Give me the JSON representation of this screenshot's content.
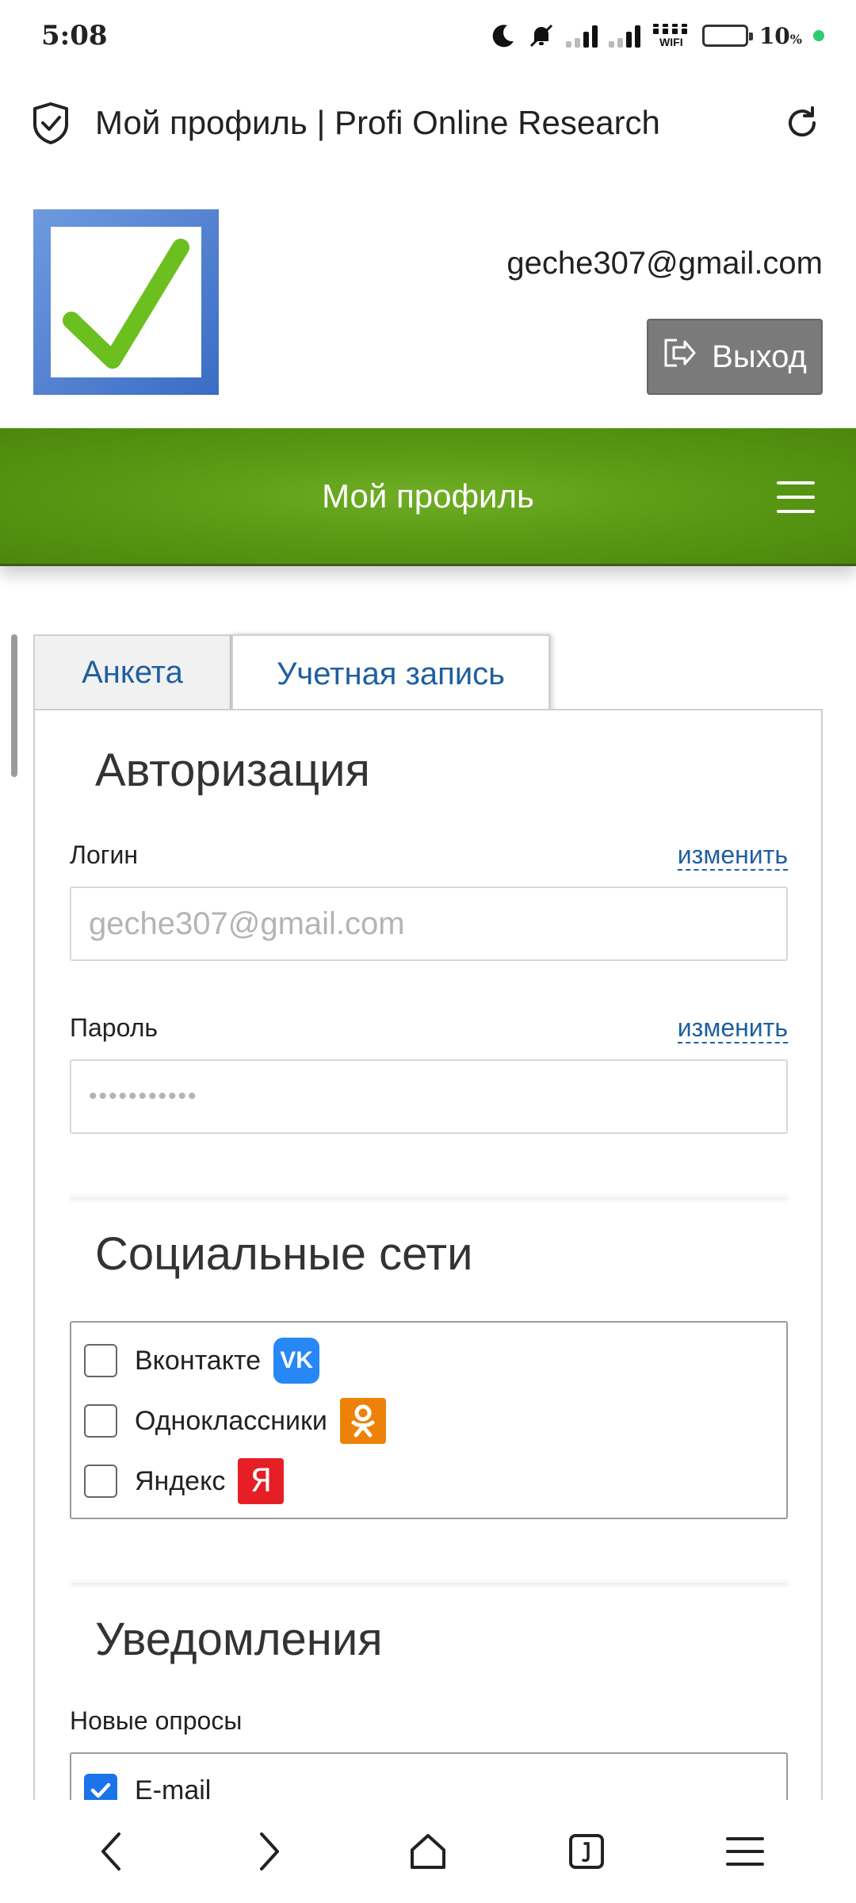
{
  "status_bar": {
    "time": "5:08",
    "wifi_label": "WIFI",
    "battery_level": 10,
    "battery_text": "10",
    "battery_unit": "%"
  },
  "browser": {
    "page_title": "Мой профиль | Profi Online Research"
  },
  "header": {
    "user_email": "geche307@gmail.com",
    "logout_label": "Выход"
  },
  "nav": {
    "title": "Мой профиль"
  },
  "tabs": [
    {
      "label": "Анкета",
      "active": false
    },
    {
      "label": "Учетная запись",
      "active": true
    }
  ],
  "auth": {
    "title": "Авторизация",
    "login_label": "Логин",
    "login_change": "изменить",
    "login_value": "geche307@gmail.com",
    "password_label": "Пароль",
    "password_change": "изменить",
    "password_value": "•••••••••••"
  },
  "social": {
    "title": "Социальные сети",
    "items": [
      {
        "label": "Вконтакте",
        "checked": false,
        "icon": "vk-icon"
      },
      {
        "label": "Одноклассники",
        "checked": false,
        "icon": "ok-icon"
      },
      {
        "label": "Яндекс",
        "checked": false,
        "icon": "yandex-icon"
      }
    ]
  },
  "notifications": {
    "title": "Уведомления",
    "new_surveys_label": "Новые опросы",
    "items": [
      {
        "label": "E-mail",
        "checked": true
      }
    ]
  },
  "colors": {
    "accent_green": "#5a9a14",
    "link_blue": "#1f5fa0",
    "checkbox_blue": "#1a73e8",
    "vk": "#2787f5",
    "ok": "#ee8208",
    "yandex": "#e61f26"
  }
}
